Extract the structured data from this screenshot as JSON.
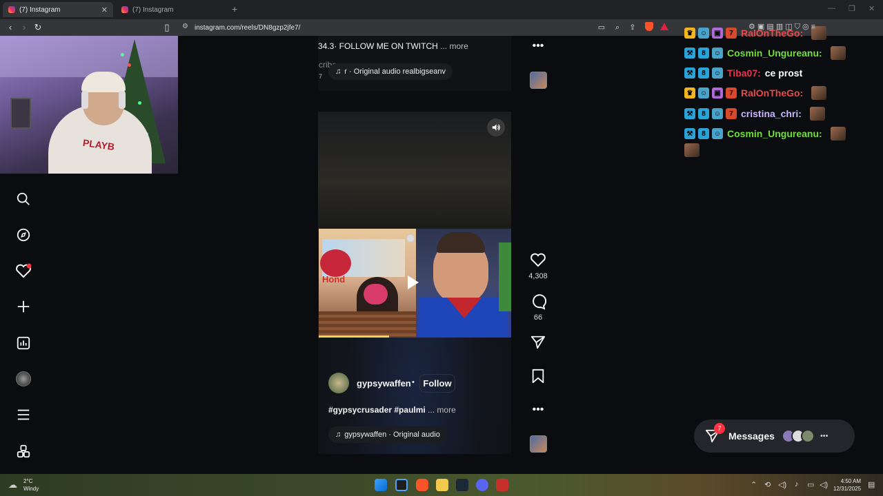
{
  "browser": {
    "tabs": [
      {
        "label": "(7) Instagram",
        "active": true
      },
      {
        "label": "(7) Instagram",
        "active": false
      }
    ],
    "url": "instagram.com/reels/DN8gzp2jfe7/"
  },
  "webcam": {
    "shirt_text": "PLAYB"
  },
  "nav": {
    "icons": [
      "search-icon",
      "explore-icon",
      "notifications-icon",
      "create-icon",
      "dashboard-icon",
      "profile-avatar",
      "menu-icon",
      "more-apps-icon"
    ]
  },
  "reel_top": {
    "caption": "34.3· FOLLOW ME ON TWITCH",
    "more": "... more",
    "faint": "cribe",
    "audio": "r · Original audio  realbigseanv",
    "small": "7"
  },
  "reel_main": {
    "username": "gypsywaffen",
    "separator": "•",
    "follow": "Follow",
    "caption": "#gypsycrusader #paulmi",
    "more": "... more",
    "audio": "gypsywaffen · Original audio",
    "likes": "4,308",
    "comments": "66",
    "video_text": "Hond"
  },
  "chat": [
    {
      "user": "RalOnTheGo:",
      "color": "#e84a4a",
      "msg": "",
      "badges": [
        "crown",
        "char",
        "gift",
        "seven"
      ]
    },
    {
      "user": "Cosmin_Ungureanu:",
      "color": "#6fe03a",
      "msg": "",
      "badges": [
        "hammer",
        "bg",
        "char"
      ]
    },
    {
      "user": "Tiba07:",
      "color": "#e8334e",
      "msg": "ce prost",
      "badges": [
        "hammer",
        "bg",
        "char"
      ]
    },
    {
      "user": "RalOnTheGo:",
      "color": "#e84a4a",
      "msg": "",
      "badges": [
        "crown",
        "char",
        "gift",
        "seven"
      ]
    },
    {
      "user": "cristina_chri:",
      "color": "#c9b7ff",
      "msg": "",
      "badges": [
        "hammer",
        "bg",
        "char",
        "seven"
      ]
    },
    {
      "user": "Cosmin_Ungureanu:",
      "color": "#6fe03a",
      "msg": "",
      "badges": [
        "hammer",
        "bg",
        "char"
      ]
    }
  ],
  "messages": {
    "label": "Messages",
    "badge": "7"
  },
  "taskbar": {
    "weather_temp": "2°C",
    "weather_desc": "Windy",
    "time": "4:50 AM",
    "date": "12/31/2025"
  }
}
